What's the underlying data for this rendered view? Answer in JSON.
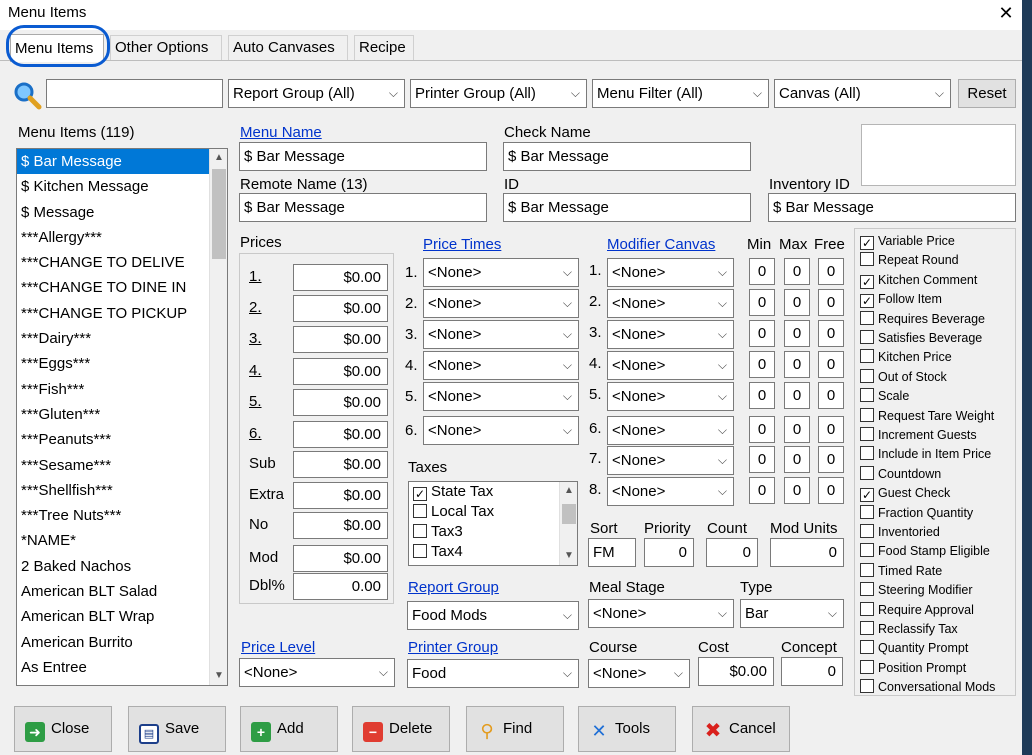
{
  "window": {
    "title": "Menu Items",
    "close_glyph": "✕"
  },
  "tabs": [
    "Menu Items",
    "Other Options",
    "Auto Canvases",
    "Recipe"
  ],
  "filters": {
    "search_value": "",
    "report_group": "Report Group (All)",
    "printer_group": "Printer Group (All)",
    "menu_filter": "Menu Filter (All)",
    "canvas": "Canvas (All)",
    "reset_label": "Reset"
  },
  "menu_list": {
    "header": "Menu Items  (119)",
    "items": [
      "$ Bar Message",
      "$ Kitchen Message",
      "$ Message",
      "***Allergy***",
      "***CHANGE TO DELIVE",
      "***CHANGE TO DINE IN",
      "***CHANGE TO PICKUP",
      "***Dairy***",
      "***Eggs***",
      "***Fish***",
      "***Gluten***",
      "***Peanuts***",
      "***Sesame***",
      "***Shellfish***",
      "***Tree Nuts***",
      "*NAME*",
      "2 Baked Nachos",
      "American BLT Salad",
      "American BLT Wrap",
      "American Burrito",
      "As Entree"
    ],
    "selected_index": 0
  },
  "fields": {
    "menu_name_label": "Menu Name",
    "menu_name": "$ Bar Message",
    "check_name_label": "Check Name",
    "check_name": "$ Bar Message",
    "remote_name_label": "Remote Name (13)",
    "remote_name": "$ Bar Message",
    "id_label": "ID",
    "id": "$ Bar Message",
    "inventory_id_label": "Inventory ID",
    "inventory_id": "$ Bar Message"
  },
  "prices": {
    "label": "Prices",
    "rows": [
      {
        "label": "1.",
        "value": "$0.00"
      },
      {
        "label": "2.",
        "value": "$0.00"
      },
      {
        "label": "3.",
        "value": "$0.00"
      },
      {
        "label": "4.",
        "value": "$0.00"
      },
      {
        "label": "5.",
        "value": "$0.00"
      },
      {
        "label": "6.",
        "value": "$0.00"
      },
      {
        "label": "Sub",
        "value": "$0.00"
      },
      {
        "label": "Extra",
        "value": "$0.00"
      },
      {
        "label": "No",
        "value": "$0.00"
      },
      {
        "label": "Mod",
        "value": "$0.00"
      },
      {
        "label": "Dbl%",
        "value": "0.00"
      }
    ]
  },
  "price_times": {
    "label": "Price Times",
    "rows": [
      {
        "num": "1.",
        "value": "<None>"
      },
      {
        "num": "2.",
        "value": "<None>"
      },
      {
        "num": "3.",
        "value": "<None>"
      },
      {
        "num": "4.",
        "value": "<None>"
      },
      {
        "num": "5.",
        "value": "<None>"
      },
      {
        "num": "6.",
        "value": "<None>"
      }
    ]
  },
  "modifier_canvas": {
    "label": "Modifier Canvas",
    "min_label": "Min",
    "max_label": "Max",
    "free_label": "Free",
    "rows": [
      {
        "num": "1.",
        "value": "<None>",
        "min": "0",
        "max": "0",
        "free": "0"
      },
      {
        "num": "2.",
        "value": "<None>",
        "min": "0",
        "max": "0",
        "free": "0"
      },
      {
        "num": "3.",
        "value": "<None>",
        "min": "0",
        "max": "0",
        "free": "0"
      },
      {
        "num": "4.",
        "value": "<None>",
        "min": "0",
        "max": "0",
        "free": "0"
      },
      {
        "num": "5.",
        "value": "<None>",
        "min": "0",
        "max": "0",
        "free": "0"
      },
      {
        "num": "6.",
        "value": "<None>",
        "min": "0",
        "max": "0",
        "free": "0"
      },
      {
        "num": "7.",
        "value": "<None>",
        "min": "0",
        "max": "0",
        "free": "0"
      },
      {
        "num": "8.",
        "value": "<None>",
        "min": "0",
        "max": "0",
        "free": "0"
      }
    ]
  },
  "taxes": {
    "label": "Taxes",
    "items": [
      {
        "label": "State Tax",
        "checked": true
      },
      {
        "label": "Local Tax",
        "checked": false
      },
      {
        "label": "Tax3",
        "checked": false
      },
      {
        "label": "Tax4",
        "checked": false
      }
    ]
  },
  "sort": {
    "sort_label": "Sort",
    "sort_value": "FM",
    "priority_label": "Priority",
    "priority_value": "0",
    "count_label": "Count",
    "count_value": "0",
    "mod_units_label": "Mod Units",
    "mod_units_value": "0"
  },
  "report_group": {
    "label": "Report Group",
    "value": "Food Mods"
  },
  "meal_stage": {
    "label": "Meal Stage",
    "value": "<None>"
  },
  "type": {
    "label": "Type",
    "value": "Bar"
  },
  "price_level": {
    "label": "Price Level",
    "value": "<None>"
  },
  "printer_group": {
    "label": "Printer Group",
    "value": "Food"
  },
  "course": {
    "label": "Course",
    "value": "<None>"
  },
  "cost": {
    "label": "Cost",
    "value": "$0.00"
  },
  "concept": {
    "label": "Concept",
    "value": "0"
  },
  "options": [
    {
      "label": "Variable Price",
      "checked": true
    },
    {
      "label": "Repeat Round",
      "checked": false
    },
    {
      "label": "Kitchen Comment",
      "checked": true
    },
    {
      "label": "Follow Item",
      "checked": true
    },
    {
      "label": "Requires Beverage",
      "checked": false
    },
    {
      "label": "Satisfies Beverage",
      "checked": false
    },
    {
      "label": "Kitchen Price",
      "checked": false
    },
    {
      "label": "Out of Stock",
      "checked": false
    },
    {
      "label": "Scale",
      "checked": false
    },
    {
      "label": "Request Tare Weight",
      "checked": false
    },
    {
      "label": "Increment Guests",
      "checked": false
    },
    {
      "label": "Include in Item Price",
      "checked": false
    },
    {
      "label": "Countdown",
      "checked": false
    },
    {
      "label": "Guest Check",
      "checked": true
    },
    {
      "label": "Fraction Quantity",
      "checked": false
    },
    {
      "label": "Inventoried",
      "checked": false
    },
    {
      "label": "Food Stamp Eligible",
      "checked": false
    },
    {
      "label": "Timed Rate",
      "checked": false
    },
    {
      "label": "Steering Modifier",
      "checked": false
    },
    {
      "label": "Require Approval",
      "checked": false
    },
    {
      "label": "Reclassify Tax",
      "checked": false
    },
    {
      "label": "Quantity Prompt",
      "checked": false
    },
    {
      "label": "Position Prompt",
      "checked": false
    },
    {
      "label": "Conversational Mods",
      "checked": false
    }
  ],
  "buttons": {
    "close": "Close",
    "save": "Save",
    "add": "Add",
    "delete": "Delete",
    "find": "Find",
    "tools": "Tools",
    "cancel": "Cancel"
  },
  "colors": {
    "selection": "#0078d7",
    "link": "#0033cc",
    "close_green": "#2e9d45",
    "add_green": "#2e9d45",
    "delete_red": "#e03c31",
    "cancel_red": "#d9201c",
    "tools_blue": "#1f6fd6",
    "circle_annotation": "#0a5bd1"
  }
}
